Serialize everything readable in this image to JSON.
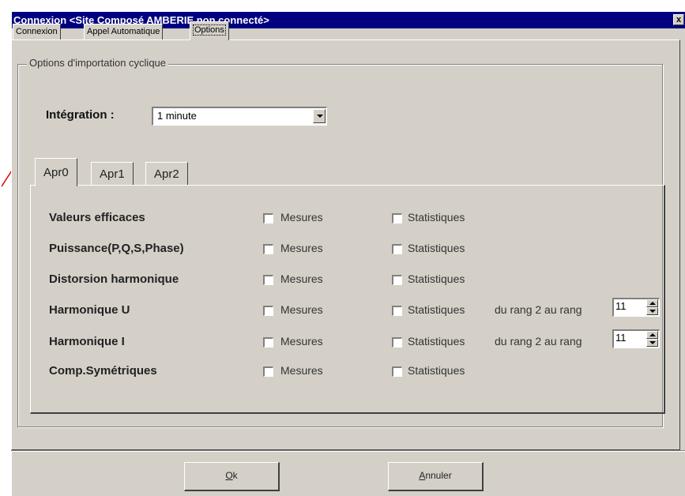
{
  "window": {
    "title": "Connexion <Site Composé AMBERIE non connecté>",
    "close_glyph": "x"
  },
  "top_tabs": [
    {
      "label": "Connexion"
    },
    {
      "label": "Appel Automatique"
    },
    {
      "label": "Options",
      "active": true
    }
  ],
  "group": {
    "legend": "Options d'importation cyclique"
  },
  "integration": {
    "label": "Intégration :",
    "value": "1 minute"
  },
  "inner_tabs": [
    {
      "label": "Apr0",
      "active": true
    },
    {
      "label": "Apr1"
    },
    {
      "label": "Apr2"
    }
  ],
  "rows": [
    {
      "label": "Valeurs efficaces",
      "mesures": "Mesures",
      "statistiques": "Statistiques",
      "mesures_checked": false,
      "stats_checked": false
    },
    {
      "label": "Puissance(P,Q,S,Phase)",
      "mesures": "Mesures",
      "statistiques": "Statistiques",
      "mesures_checked": false,
      "stats_checked": false
    },
    {
      "label": "Distorsion harmonique",
      "mesures": "Mesures",
      "statistiques": "Statistiques",
      "mesures_checked": false,
      "stats_checked": false
    },
    {
      "label": "Harmonique U",
      "mesures": "Mesures",
      "statistiques": "Statistiques",
      "range_label": "du rang 2 au rang",
      "range_value": "11",
      "mesures_checked": false,
      "stats_checked": false
    },
    {
      "label": "Harmonique I",
      "mesures": "Mesures",
      "statistiques": "Statistiques",
      "range_label": "du rang 2 au rang",
      "range_value": "11",
      "mesures_checked": false,
      "stats_checked": false
    },
    {
      "label": "Comp.Symétriques",
      "mesures": "Mesures",
      "statistiques": "Statistiques",
      "mesures_checked": false,
      "stats_checked": false
    }
  ],
  "buttons": {
    "ok_mnemonic": "O",
    "ok_rest": "k",
    "cancel_mnemonic": "A",
    "cancel_rest": "nnuler"
  },
  "colors": {
    "titlebar": "#000080",
    "face": "#d4d0c8",
    "annotation_arrow": "#ff0000"
  }
}
